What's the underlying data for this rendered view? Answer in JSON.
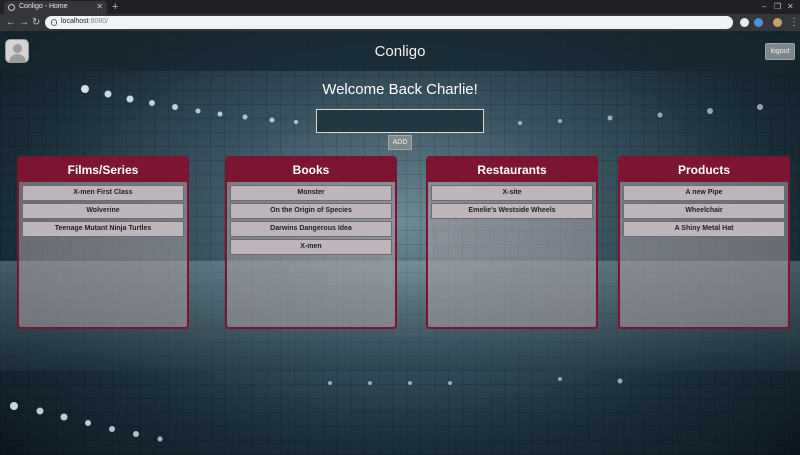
{
  "browser": {
    "tab_title": "Conligo - Home",
    "url_host": "localhost",
    "url_port": ":8080/"
  },
  "header": {
    "brand": "Conligo",
    "logout_label": "logout"
  },
  "welcome": "Welcome Back Charlie!",
  "entry": {
    "value": "",
    "add_label": "ADD"
  },
  "panels": [
    {
      "title": "Films/Series",
      "items": [
        "X-men First Class",
        "Wolverine",
        "Teenage Mutant Ninja Turtles"
      ]
    },
    {
      "title": "Books",
      "items": [
        "Monster",
        "On the Origin of Species",
        "Darwins Dangerous Idea",
        "X-men"
      ]
    },
    {
      "title": "Restaurants",
      "items": [
        "X-site",
        "Emelie's Westside Wheels"
      ]
    },
    {
      "title": "Products",
      "items": [
        "A new Pipe",
        "Wheelchair",
        "A Shiny Metal Hat"
      ]
    }
  ],
  "colors": {
    "panel_header": "#7c1532",
    "panel_border": "#7a1430",
    "header_bar": "#162630"
  }
}
